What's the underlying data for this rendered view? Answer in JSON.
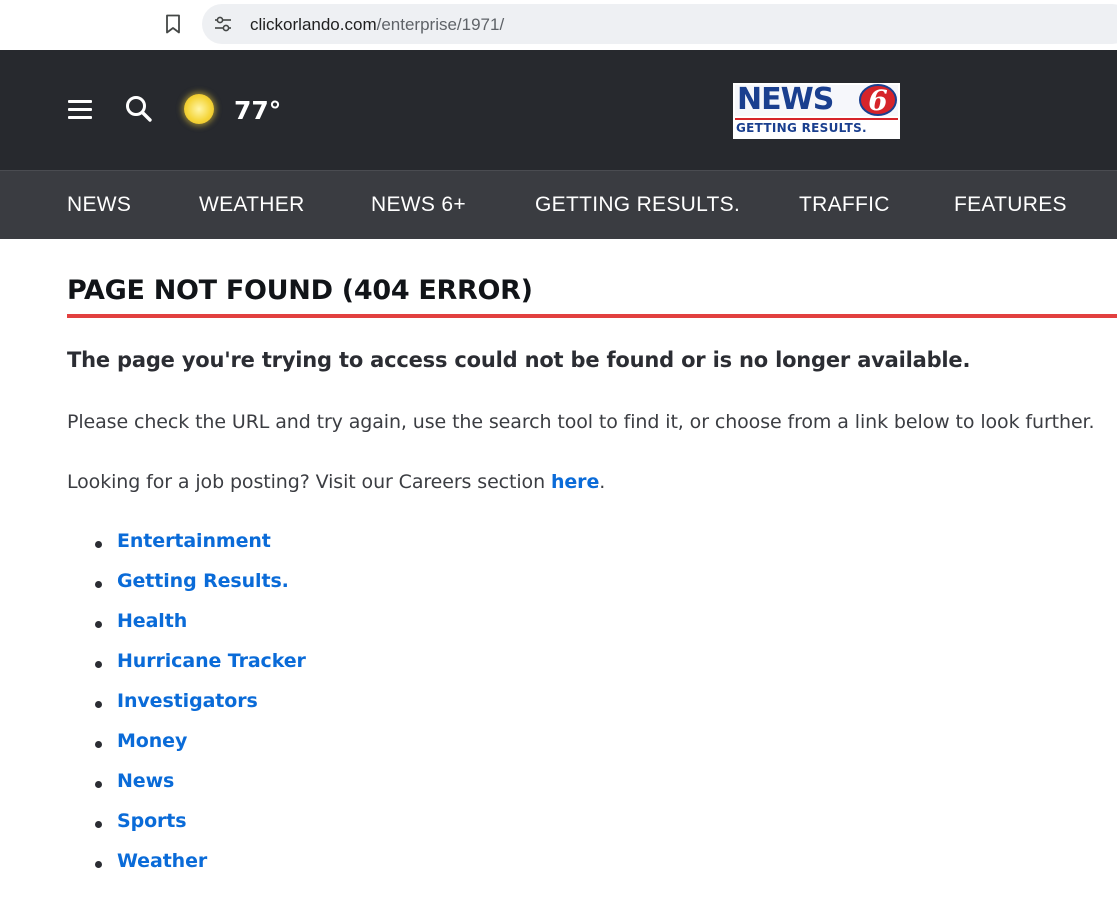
{
  "browser": {
    "url_domain": "clickorlando.com",
    "url_path": "/enterprise/1971/"
  },
  "header": {
    "temperature": "77°",
    "logo": {
      "name": "NEWS",
      "number": "6",
      "tagline": "GETTING RESULTS."
    }
  },
  "nav": {
    "items": [
      {
        "label": "NEWS"
      },
      {
        "label": "WEATHER"
      },
      {
        "label": "NEWS 6+"
      },
      {
        "label": "GETTING RESULTS."
      },
      {
        "label": "TRAFFIC"
      },
      {
        "label": "FEATURES"
      }
    ]
  },
  "content": {
    "title": "PAGE NOT FOUND (404 ERROR)",
    "lead": "The page you're trying to access could not be found or is no longer available.",
    "instructions": "Please check the URL and try again, use the search tool to find it, or choose from a link below to look further.",
    "careers_prefix": "Looking for a job posting? Visit our Careers section ",
    "careers_link": "here",
    "careers_suffix": ".",
    "links": [
      "Entertainment",
      "Getting Results.",
      "Health",
      "Hurricane Tracker",
      "Investigators",
      "Money",
      "News",
      "Sports",
      "Weather"
    ]
  },
  "colors": {
    "header_bg": "#27292e",
    "nav_bg": "#3a3c41",
    "accent_rule": "#e2403f",
    "link": "#0a6bd8"
  },
  "icons": [
    "bookmark-icon",
    "site-info-icon",
    "hamburger-menu-icon",
    "search-icon",
    "sunny-weather-icon"
  ]
}
